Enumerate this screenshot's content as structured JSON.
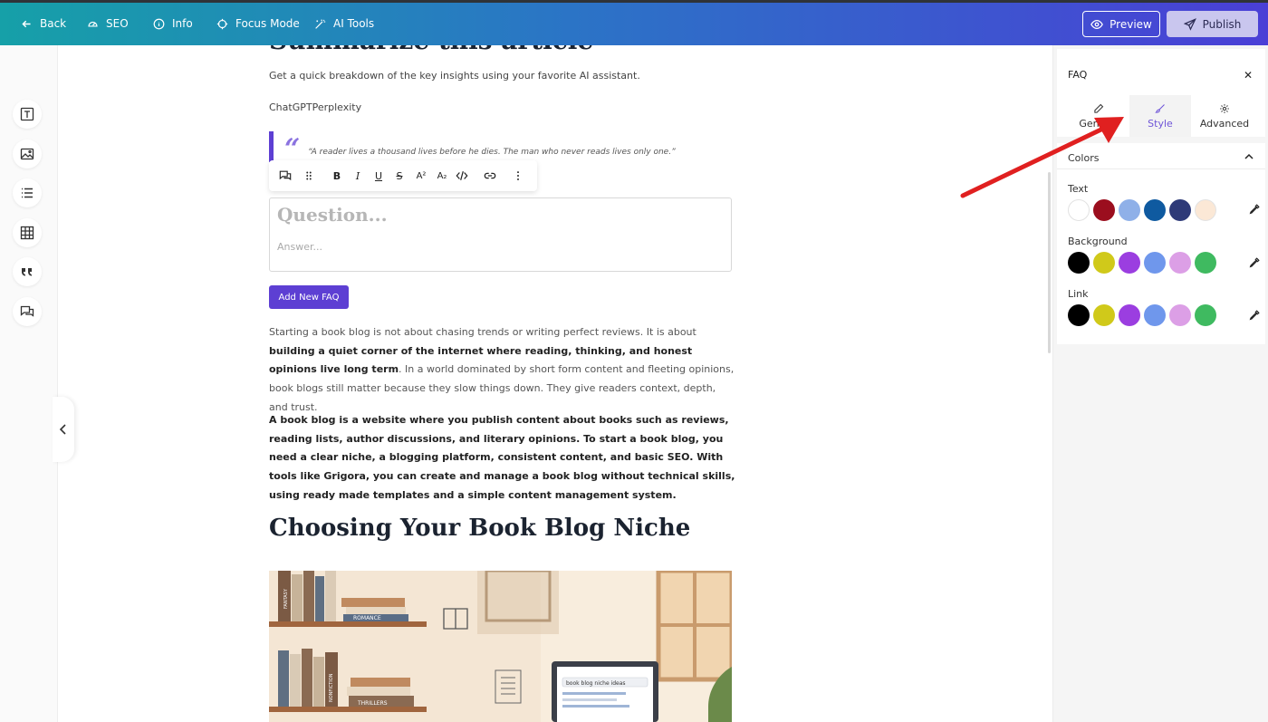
{
  "topbar": {
    "back": "Back",
    "seo": "SEO",
    "info": "Info",
    "focus_mode": "Focus Mode",
    "ai_tools": "AI Tools",
    "preview": "Preview",
    "publish": "Publish"
  },
  "editor": {
    "cut_title": "Summarize this article",
    "summary_text": "Get a quick breakdown of the key insights using your favorite AI assistant.",
    "assistants": "ChatGPTPerplexity",
    "quote_mark": "“",
    "quote": "“A reader lives a thousand lives before he dies. The man who never reads lives only one.”",
    "faq_question_placeholder": "Question...",
    "faq_answer_placeholder": "Answer...",
    "add_faq": "Add New FAQ",
    "para1_a": "Starting a book blog is not about chasing trends or writing perfect reviews. It is about ",
    "para1_b": "building a quiet corner of the internet where reading, thinking, and honest opinions live long term",
    "para1_c": ". In a world dominated by short form content and fleeting opinions, book blogs still matter because they slow things down. They give readers context, depth, and trust.",
    "para2": "A book blog is a website where you publish content about books such as reviews, reading lists, author discussions, and literary opinions. To start a book blog, you need a clear niche, a blogging platform, consistent content, and basic SEO. With tools like Grigora, you can create and manage a book blog without technical skills, using ready made templates and a simple content management system.",
    "h2": "Choosing Your Book Blog Niche",
    "illus_labels": {
      "fantasy": "FANTASY",
      "romance": "ROMANCE",
      "nonfiction": "NONFICTION",
      "thrillers": "THRILLERS",
      "search": "book blog niche ideas"
    }
  },
  "toolbar": {
    "bold": "B",
    "italic": "I",
    "underline": "U",
    "strike": "S",
    "superscript": "A²",
    "subscript": "A₂"
  },
  "panel": {
    "title": "FAQ",
    "close": "✕",
    "tabs": [
      "General",
      "Style",
      "Advanced"
    ],
    "colors_heading": "Colors",
    "groups": [
      {
        "label": "Text",
        "swatches": [
          "#ffffff",
          "#9b0e1e",
          "#8fb0e8",
          "#0f5aa0",
          "#2e3a78",
          "#fbe8d6"
        ]
      },
      {
        "label": "Background",
        "swatches": [
          "#000000",
          "#d0c91a",
          "#9b3ee0",
          "#6f97ec",
          "#dc9fe6",
          "#3fba60"
        ]
      },
      {
        "label": "Link",
        "swatches": [
          "#000000",
          "#d0c91a",
          "#9b3ee0",
          "#6f97ec",
          "#dc9fe6",
          "#3fba60"
        ]
      }
    ]
  },
  "colors": {
    "accent": "#5d3fd3",
    "arrow": "#e02020"
  }
}
